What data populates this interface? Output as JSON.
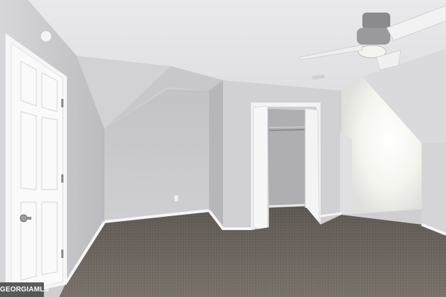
{
  "photo": {
    "description_tags": [
      "attic-bedroom",
      "carpet-floor",
      "closet",
      "ceiling-fan",
      "skylight-window"
    ]
  },
  "watermark": {
    "text": "GEORGIAMLS"
  },
  "colors": {
    "wall_light": "#e3e3e5",
    "wall_shadow": "#b9b9bd",
    "ceiling": "#ececee",
    "carpet": "#6d6660",
    "trim_white": "#f6f6f6",
    "window_glow": "#fbfbf6"
  }
}
